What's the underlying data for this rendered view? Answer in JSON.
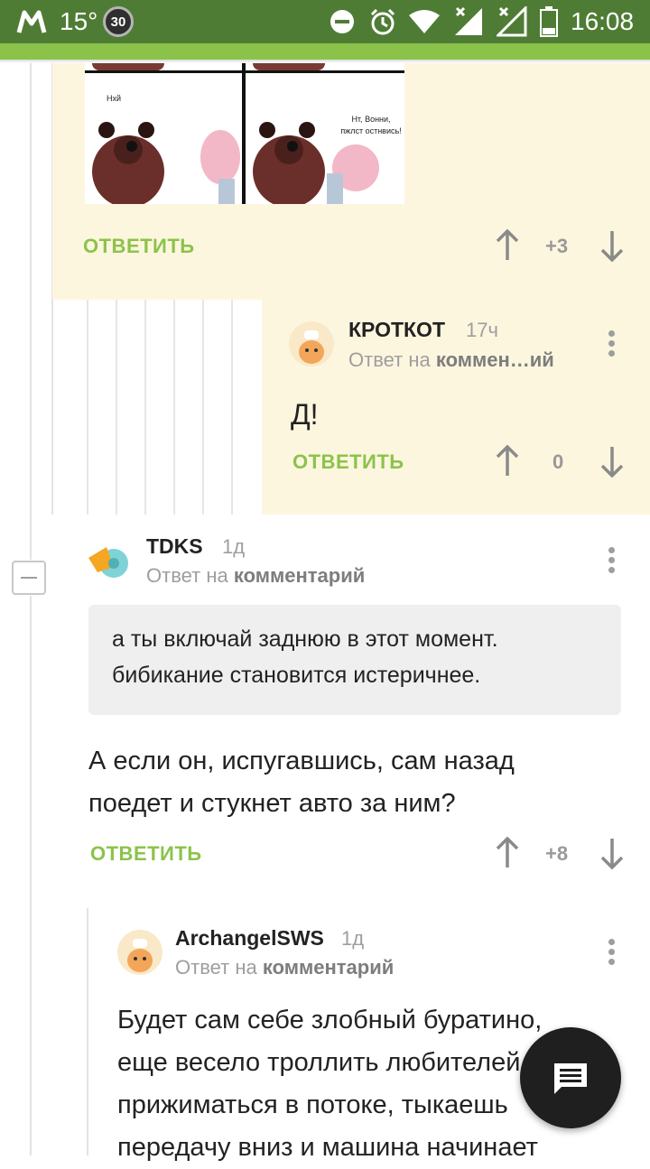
{
  "status_bar": {
    "temperature": "15°",
    "badge_number": "30",
    "time": "16:08"
  },
  "comic": {
    "left_caption": "Нхй",
    "right_caption_line1": "Нт, Вонни,",
    "right_caption_line2": "пжлст остнвись!"
  },
  "labels": {
    "reply_button": "ОТВЕТИТЬ",
    "reply_to_prefix": "Ответ на"
  },
  "comments": [
    {
      "vote_score": "+3"
    },
    {
      "username": "КРОТКОТ",
      "time": "17ч",
      "reply_to": "коммен…ий",
      "text": "Д!",
      "vote_score": "0"
    },
    {
      "username": "TDKS",
      "time": "1д",
      "reply_to": "комментарий",
      "quote_line1": "а ты включай заднюю в этот момент.",
      "quote_line2": "бибикание становится истеричнее.",
      "text_line1": "А если он, испугавшись, сам назад",
      "text_line2": "поедет и стукнет авто за ним?",
      "vote_score": "+8"
    },
    {
      "username": "ArchangelSWS",
      "time": "1д",
      "reply_to": "комментарий",
      "text_line1": "Будет сам себе злобный буратино,",
      "text_line2": "еще весело троллить любителей",
      "text_line3": "прижиматься в потоке, тыкаешь",
      "text_line4": "передачу вниз и машина начинает"
    }
  ],
  "colors": {
    "status_bar": "#4f7c35",
    "accent_green": "#8bc34a",
    "highlight_bg": "#fdf6df",
    "fab_bg": "#1f1f1f"
  },
  "icons": [
    "app-logo-icon",
    "dnd-icon",
    "alarm-icon",
    "wifi-icon",
    "signal-icon",
    "battery-icon",
    "upvote-icon",
    "downvote-icon",
    "more-options-icon",
    "collapse-icon",
    "chat-icon"
  ]
}
